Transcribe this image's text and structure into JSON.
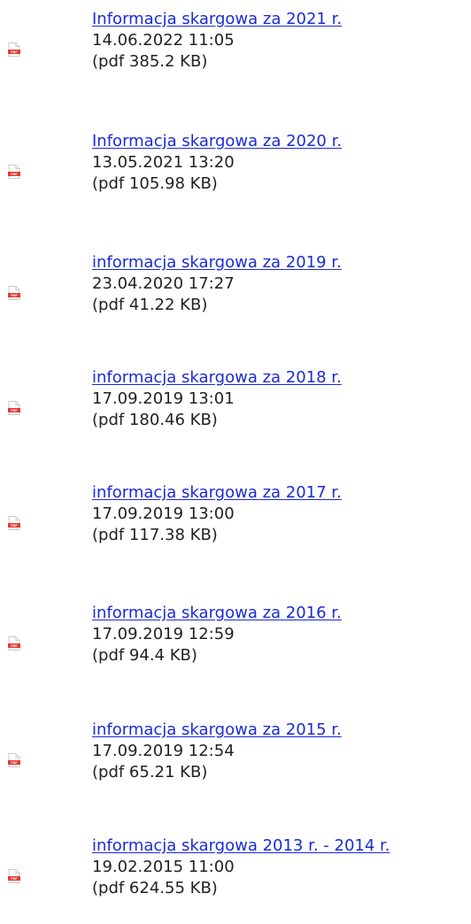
{
  "files": [
    {
      "title": "Informacja skargowa za 2021 r.",
      "date": "14.06.2022 11:05",
      "meta": "(pdf 385.2 KB)",
      "icon": "pdf-file-icon"
    },
    {
      "title": "Informacja skargowa za 2020 r.",
      "date": "13.05.2021 13:20",
      "meta": "(pdf 105.98 KB)",
      "icon": "pdf-file-icon"
    },
    {
      "title": "informacja skargowa za 2019 r.",
      "date": "23.04.2020 17:27",
      "meta": "(pdf 41.22 KB)",
      "icon": "pdf-file-icon"
    },
    {
      "title": "informacja skargowa za 2018 r.",
      "date": "17.09.2019 13:01",
      "meta": "(pdf 180.46 KB)",
      "icon": "pdf-file-icon"
    },
    {
      "title": "informacja skargowa za 2017 r.",
      "date": "17.09.2019 13:00",
      "meta": "(pdf 117.38 KB)",
      "icon": "pdf-file-icon"
    },
    {
      "title": "informacja skargowa za 2016 r.",
      "date": "17.09.2019 12:59",
      "meta": "(pdf 94.4 KB)",
      "icon": "pdf-file-icon"
    },
    {
      "title": "informacja skargowa za 2015 r.",
      "date": "17.09.2019 12:54",
      "meta": "(pdf 65.21 KB)",
      "icon": "pdf-file-icon"
    },
    {
      "title": "informacja skargowa 2013 r. - 2014 r.",
      "date": "19.02.2015 11:00",
      "meta": "(pdf 624.55 KB)",
      "icon": "pdf-file-icon"
    }
  ],
  "colors": {
    "link": "#1a2bd8",
    "text": "#222222",
    "pdf_badge": "#e53935"
  }
}
